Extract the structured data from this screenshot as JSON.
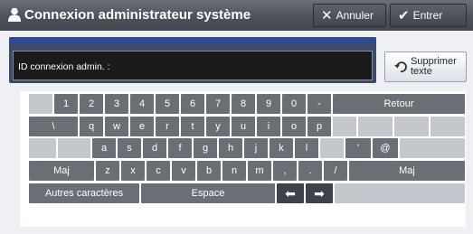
{
  "window": {
    "title": "Connexion administrateur système",
    "cancel_label": "Annuler",
    "enter_label": "Entrer"
  },
  "input": {
    "label": "ID connexion admin. :",
    "value": ""
  },
  "delete_text": {
    "label": "Supprimer\ntexte"
  },
  "keyboard": {
    "row1": [
      "1",
      "2",
      "3",
      "4",
      "5",
      "6",
      "7",
      "8",
      "9",
      "0",
      "-"
    ],
    "backspace_label": "Retour",
    "row2": [
      "\\",
      "q",
      "w",
      "e",
      "r",
      "t",
      "y",
      "u",
      "i",
      "o",
      "p"
    ],
    "row3": [
      "a",
      "s",
      "d",
      "f",
      "g",
      "h",
      "j",
      "k",
      "l"
    ],
    "row3_extra": [
      "'",
      "@"
    ],
    "shift_label": "Maj",
    "row4": [
      "z",
      "x",
      "c",
      "v",
      "b",
      "n",
      "m",
      ",",
      ".",
      "/"
    ],
    "other_chars_label": "Autres caractères",
    "space_label": "Espace",
    "left_arrow": "⬅",
    "right_arrow": "➡"
  },
  "colors": {
    "titlebar": "#4d5159",
    "key": "#6a6e75",
    "key_dark": "#3f4248",
    "key_disabled": "#c4c7cc",
    "panel_accent": "#2e4b96"
  }
}
